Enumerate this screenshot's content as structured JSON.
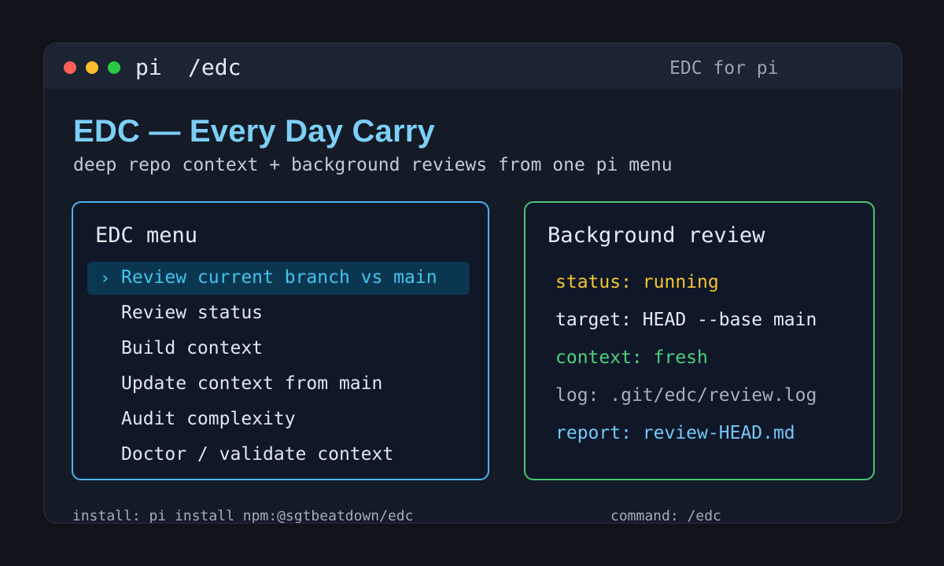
{
  "window": {
    "app_name": "pi",
    "command": "/edc",
    "right_title": "EDC for pi",
    "traffic_colors": {
      "close": "#ff5f57",
      "minimize": "#febc2e",
      "zoom": "#28c840"
    }
  },
  "header": {
    "title": "EDC — Every Day Carry",
    "subtitle": "deep repo context + background reviews from one pi menu"
  },
  "menu": {
    "title": "EDC menu",
    "selected_marker": "›",
    "items": [
      {
        "label": "Review current branch vs main",
        "selected": true
      },
      {
        "label": "Review status",
        "selected": false
      },
      {
        "label": "Build context",
        "selected": false
      },
      {
        "label": "Update context from main",
        "selected": false
      },
      {
        "label": "Audit complexity",
        "selected": false
      },
      {
        "label": "Doctor / validate context",
        "selected": false
      }
    ]
  },
  "review": {
    "title": "Background review",
    "lines": [
      {
        "key": "status:",
        "value": "running",
        "key_color": "#f4c430",
        "value_color": "#f4c430"
      },
      {
        "key": "target:",
        "value": "HEAD --base main",
        "key_color": "#e6e9ef",
        "value_color": "#e6e9ef"
      },
      {
        "key": "context:",
        "value": "fresh",
        "key_color": "#4cd17a",
        "value_color": "#4cd17a"
      },
      {
        "key": "log:",
        "value": ".git/edc/review.log",
        "key_color": "#a7afbc",
        "value_color": "#a7afbc"
      },
      {
        "key": "report:",
        "value": "review-HEAD.md",
        "key_color": "#74c8f6",
        "value_color": "#74c8f6"
      }
    ]
  },
  "footer": {
    "install": "install: pi install npm:@sgtbeatdown/edc",
    "command": "command: /edc"
  }
}
